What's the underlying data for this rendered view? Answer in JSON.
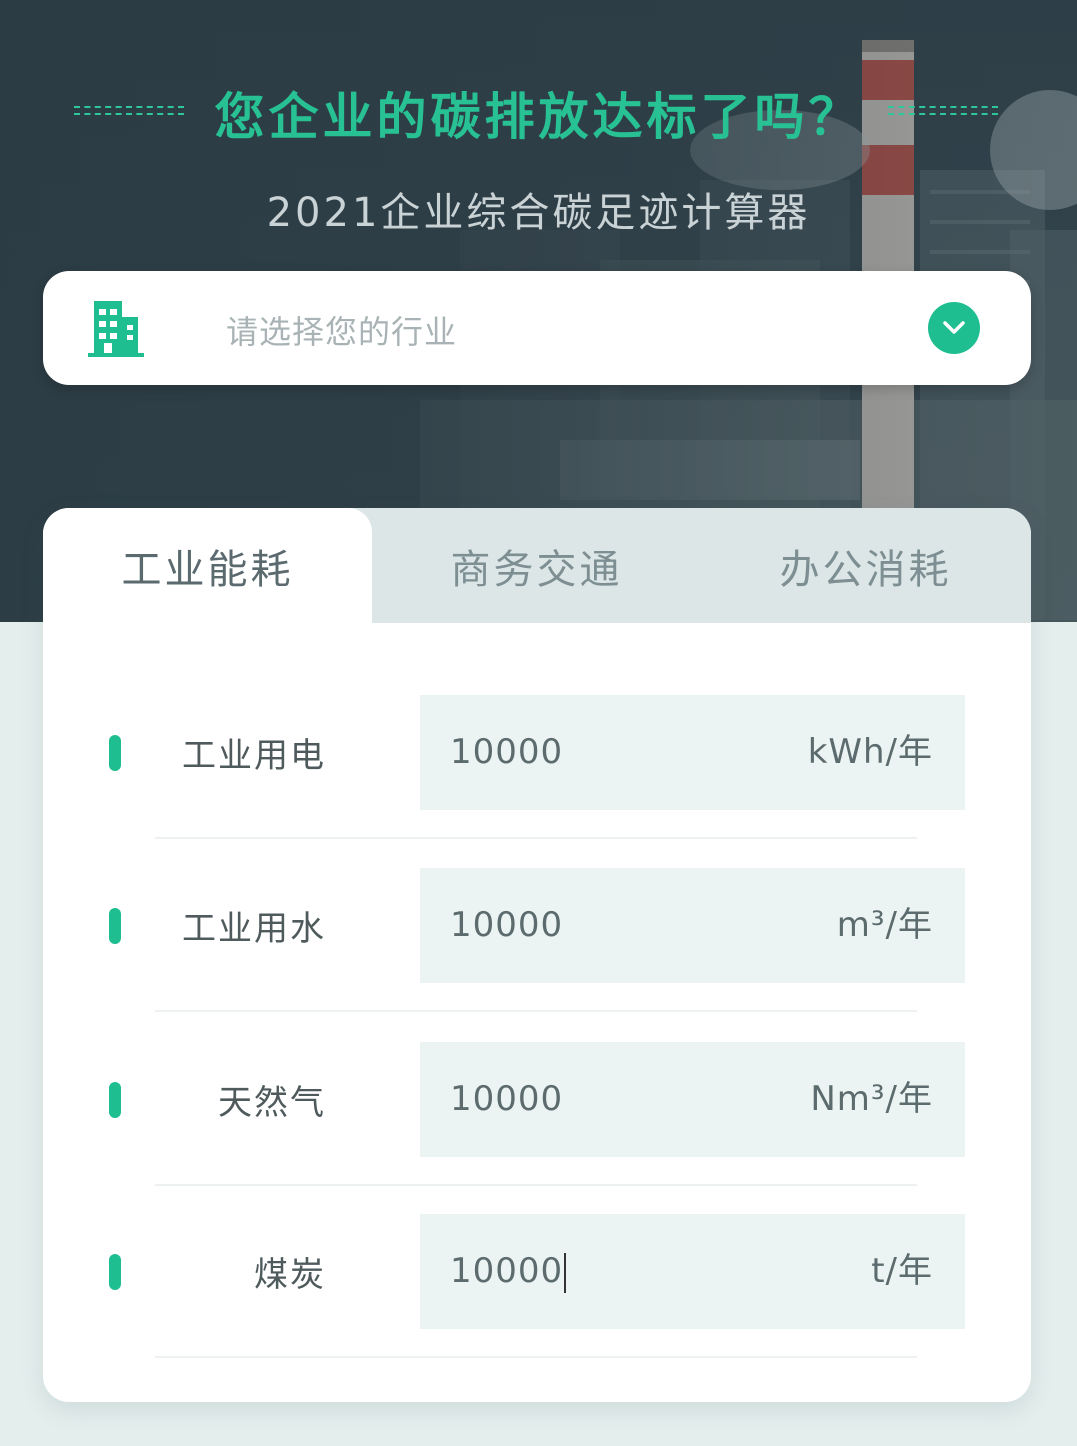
{
  "header": {
    "headline": "您企业的碳排放达标了吗？",
    "subtitle": "2021企业综合碳足迹计算器"
  },
  "industry_select": {
    "icon": "building-icon",
    "placeholder": "请选择您的行业",
    "chevron_icon": "chevron-down-icon"
  },
  "tabs": [
    {
      "label": "工业能耗",
      "active": true
    },
    {
      "label": "商务交通",
      "active": false
    },
    {
      "label": "办公消耗",
      "active": false
    }
  ],
  "rows": [
    {
      "label": "工业用电",
      "value": "10000",
      "unit": "kWh/年"
    },
    {
      "label": "工业用水",
      "value": "10000",
      "unit": "m³/年"
    },
    {
      "label": "天然气",
      "value": "10000",
      "unit": "Nm³/年"
    },
    {
      "label": "煤炭",
      "value": "10000",
      "unit": "t/年"
    }
  ],
  "colors": {
    "accent": "#1fbe90",
    "headline": "#27c194",
    "hero_bg": "#2f3f49",
    "page_bg": "#e4eeed",
    "field_bg": "#ecf4f3"
  }
}
